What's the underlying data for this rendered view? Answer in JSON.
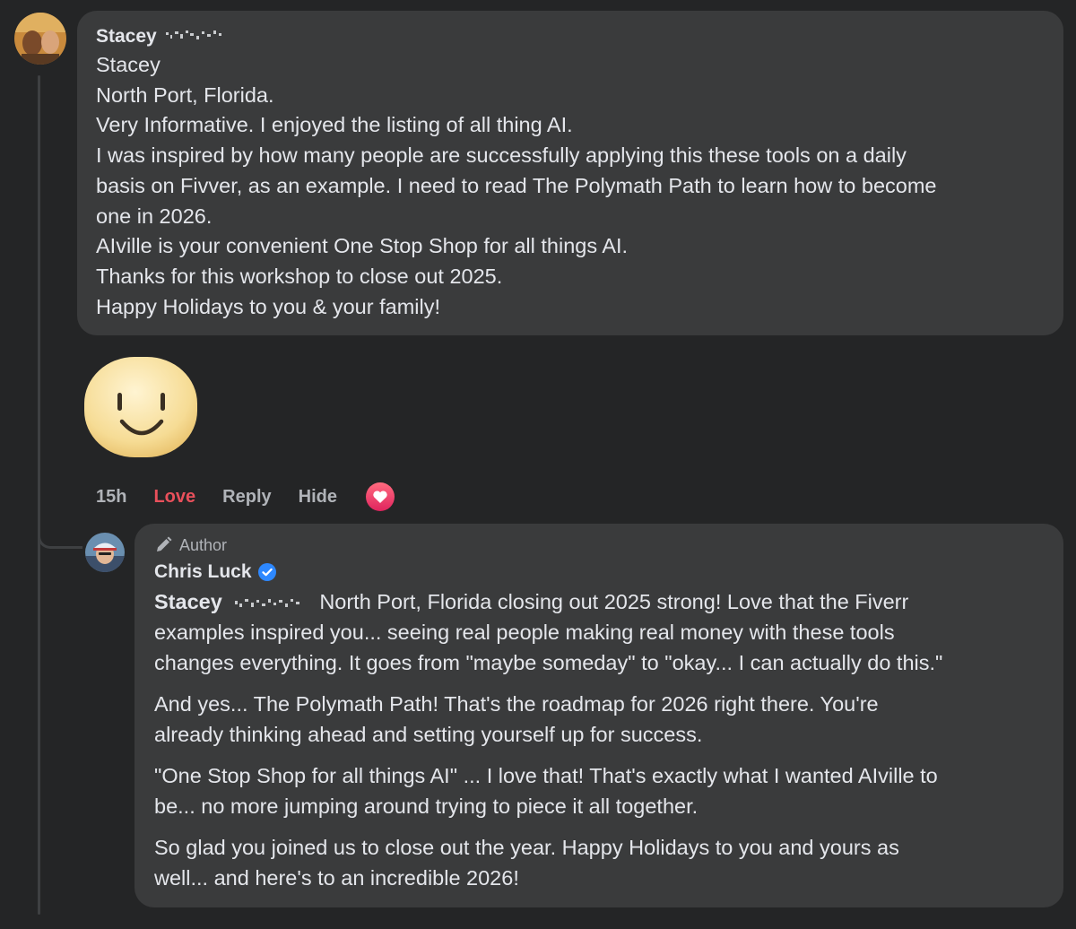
{
  "comment": {
    "author_name": "Stacey",
    "lines": [
      "Stacey",
      "North Port, Florida.",
      "Very Informative. I enjoyed the listing of all thing AI.",
      "I was inspired by how many people are successfully applying this these tools on a daily",
      "basis on Fivver, as an example. I need to read The Polymath Path to learn how to become",
      "one in 2026.",
      "AIville is your convenient One Stop Shop for all things AI.",
      "Thanks for this workshop to close out 2025.",
      "Happy Holidays to you & your family!"
    ],
    "sticker": "smiley-face",
    "actions": {
      "timestamp": "15h",
      "love": "Love",
      "reply": "Reply",
      "hide": "Hide"
    },
    "reaction": "heart"
  },
  "reply": {
    "badge": "Author",
    "author_name": "Chris Luck",
    "verified": true,
    "mention": "Stacey",
    "paragraphs": [
      {
        "lines": [
          "North Port, Florida closing out 2025 strong! Love that the Fiverr",
          "examples inspired you... seeing real people making real money with these tools",
          "changes everything. It goes from \"maybe someday\" to \"okay... I can actually do this.\""
        ]
      },
      {
        "lines": [
          "And yes... The Polymath Path! That's the roadmap for 2026 right there. You're",
          "already thinking ahead and setting yourself up for success."
        ]
      },
      {
        "lines": [
          "\"One Stop Shop for all things AI\" ... I love that! That's exactly what I wanted AIville to",
          "be... no more jumping around trying to piece it all together."
        ]
      },
      {
        "lines": [
          "So glad you joined us to close out the year. Happy Holidays to you and yours as",
          "well... and here's to an incredible 2026!"
        ]
      }
    ]
  },
  "colors": {
    "background": "#242526",
    "bubble": "#3a3b3c",
    "text": "#e4e6eb",
    "muted": "#b0b3b8",
    "love": "#e9505b",
    "verified": "#2d88ff"
  }
}
